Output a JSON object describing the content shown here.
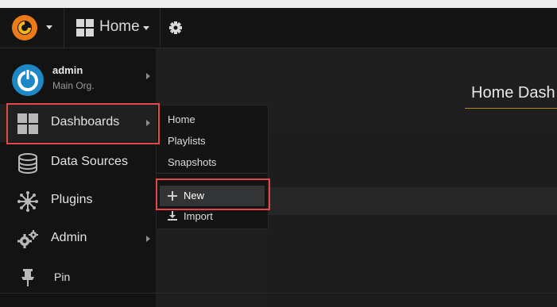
{
  "topbar": {
    "home_label": "Home"
  },
  "sidebar": {
    "user": {
      "name": "admin",
      "org": "Main Org."
    },
    "items": [
      {
        "label": "Dashboards"
      },
      {
        "label": "Data Sources"
      },
      {
        "label": "Plugins"
      },
      {
        "label": "Admin"
      },
      {
        "label": "Pin"
      }
    ]
  },
  "submenu": {
    "items": [
      {
        "label": "Home"
      },
      {
        "label": "Playlists"
      },
      {
        "label": "Snapshots"
      },
      {
        "label": "New"
      },
      {
        "label": "Import"
      }
    ]
  },
  "main": {
    "title": "Home Dash"
  },
  "colors": {
    "highlight": "#e04a4a",
    "accent": "#ad8b28",
    "brand": "#f05a28"
  }
}
